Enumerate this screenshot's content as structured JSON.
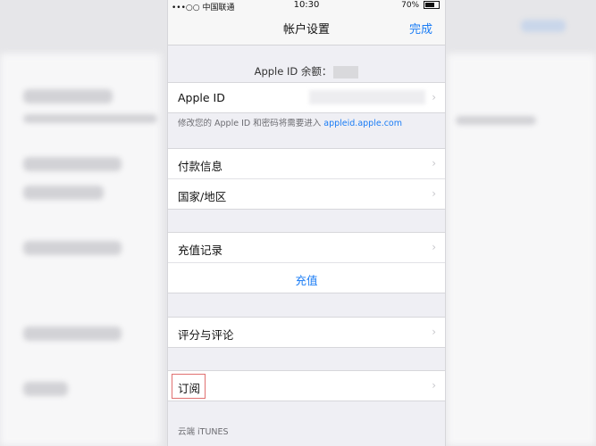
{
  "status_bar": {
    "carrier": "•••○○ 中国联通",
    "time": "10:30",
    "battery": "70%"
  },
  "nav": {
    "title": "帐户设置",
    "done": "完成"
  },
  "balance_label": "Apple ID 余额：",
  "account": {
    "apple_id_label": "Apple ID",
    "footnote_prefix": "修改您的 Apple ID 和密码将需要进入",
    "footnote_link": "appleid.apple.com"
  },
  "payment": {
    "payment_info": "付款信息",
    "region": "国家/地区"
  },
  "topup": {
    "history": "充值记录",
    "topup": "充值"
  },
  "ratings": {
    "label": "评分与评论"
  },
  "subscriptions": {
    "label": "订阅"
  },
  "section_footer": "云端 iTUNES",
  "icons": {
    "chevron": "chevron-right-icon",
    "wifi": "wifi-icon",
    "battery": "battery-icon"
  },
  "colors": {
    "accent": "#1a7cf5",
    "highlight_border": "#e07070"
  }
}
